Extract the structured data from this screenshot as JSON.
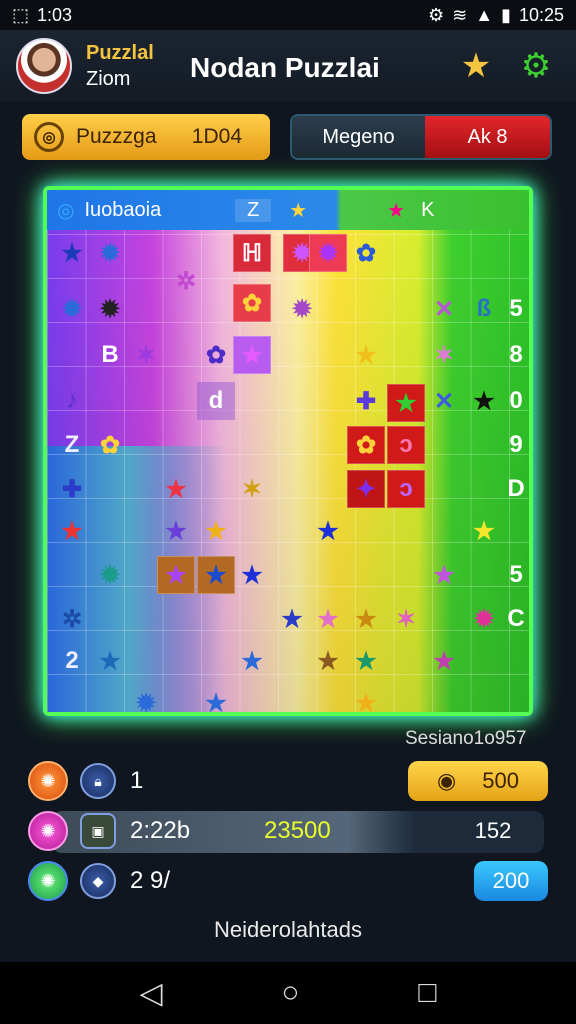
{
  "status": {
    "time_left": "1:03",
    "time_right": "10:25"
  },
  "header": {
    "user_name": "Puzzlal",
    "user_level": "Ziom",
    "title": "Nodan Puzzlai"
  },
  "topbar": {
    "left_label": "Puzzzga",
    "left_value": "1D04",
    "right_label": "Megeno",
    "right_value": "Ak 8"
  },
  "board": {
    "header_text": "Iuobaoia",
    "header_z": "Z",
    "header_k": "K",
    "right_column": [
      "5",
      "8",
      "0",
      "9",
      "D",
      "5",
      "C"
    ],
    "left_column": [
      "B",
      "d",
      "Z",
      "2"
    ]
  },
  "session_label": "Sesiano1o957",
  "stats": [
    {
      "left": "1",
      "right": "500"
    },
    {
      "left": "2:22b",
      "mid": "23500",
      "right": "152"
    },
    {
      "left": "2 9/",
      "right": "200"
    }
  ],
  "footer": "Neiderolahtads",
  "colors": {
    "gold": "#f5c542",
    "green": "#54ff54",
    "cyan": "#3cf0ff",
    "red": "#e3262b",
    "blue": "#1aa6e8"
  }
}
